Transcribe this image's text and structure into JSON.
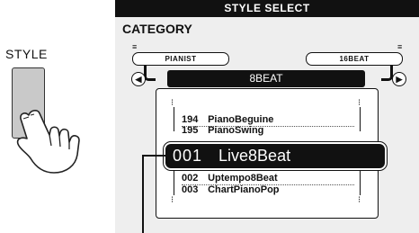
{
  "left_panel": {
    "button_label": "STYLE"
  },
  "screen": {
    "header_title": "STYLE SELECT",
    "category_label": "CATEGORY",
    "category_prev": "PIANIST",
    "category_next": "16BEAT",
    "current_category": "8BEAT",
    "arrow_left_glyph": "◀",
    "arrow_right_glyph": "▶",
    "styles": [
      {
        "number": "194",
        "name": "PianoBeguine"
      },
      {
        "number": "195",
        "name": "PianoSwing"
      },
      {
        "number": "001",
        "name": "Live8Beat"
      },
      {
        "number": "002",
        "name": "Uptempo8Beat"
      },
      {
        "number": "003",
        "name": "ChartPianoPop"
      }
    ],
    "selected_index": 2
  },
  "colors": {
    "lcd_background": "#eeeeee",
    "lcd_ink": "#111111",
    "button_fill": "#c9c9c9"
  }
}
